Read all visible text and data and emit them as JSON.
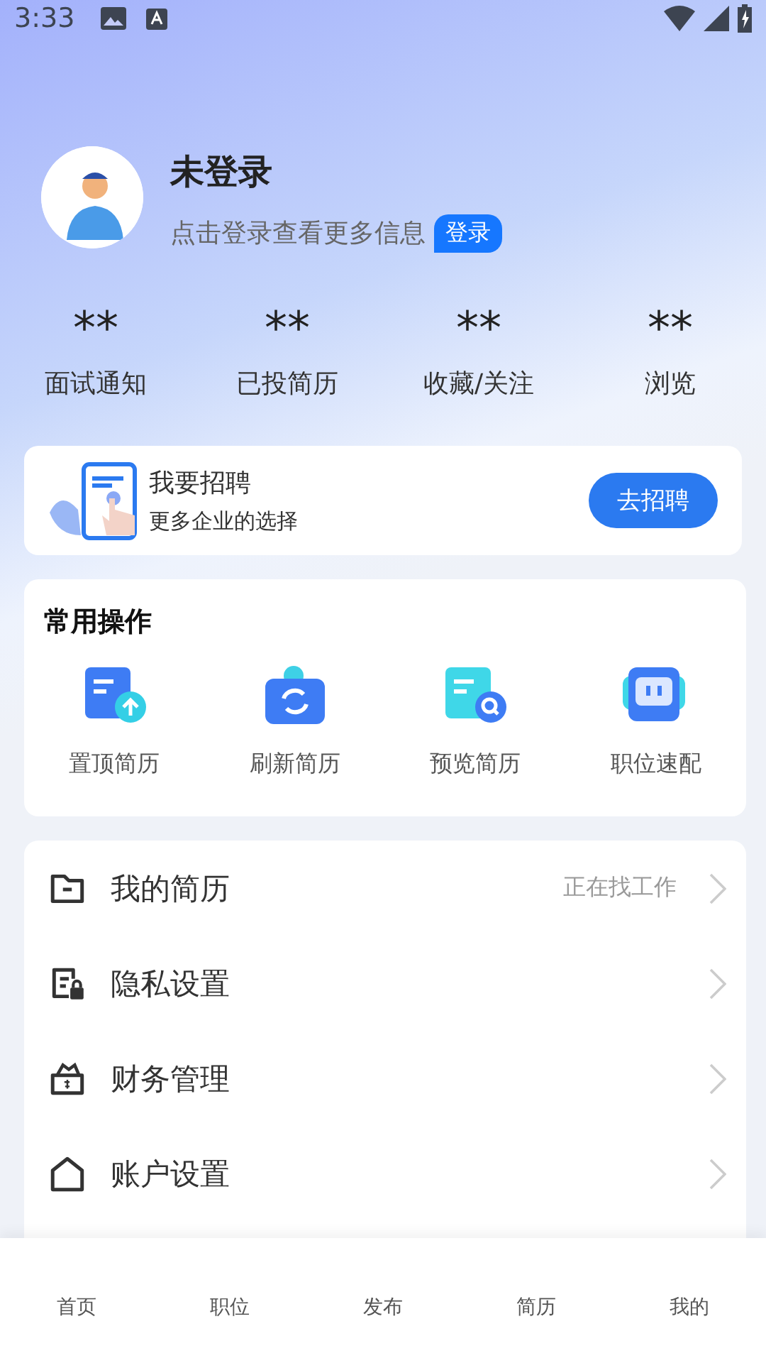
{
  "status_bar": {
    "time": "3:33"
  },
  "profile": {
    "name": "未登录",
    "hint": "点击登录查看更多信息",
    "login_button": "登录"
  },
  "stats": [
    {
      "value": "**",
      "label": "面试通知"
    },
    {
      "value": "**",
      "label": "已投简历"
    },
    {
      "value": "**",
      "label": "收藏/关注"
    },
    {
      "value": "**",
      "label": "浏览"
    }
  ],
  "recruit_card": {
    "title": "我要招聘",
    "subtitle": "更多企业的选择",
    "button": "去招聘"
  },
  "common_actions": {
    "title": "常用操作",
    "items": [
      {
        "kind": "pin",
        "label": "置顶简历"
      },
      {
        "kind": "refresh",
        "label": "刷新简历"
      },
      {
        "kind": "preview",
        "label": "预览简历"
      },
      {
        "kind": "match",
        "label": "职位速配"
      }
    ]
  },
  "menu": [
    {
      "kind": "folder",
      "label": "我的简历",
      "value": "正在找工作"
    },
    {
      "kind": "privacy",
      "label": "隐私设置"
    },
    {
      "kind": "finance",
      "label": "财务管理"
    },
    {
      "kind": "account",
      "label": "账户设置"
    }
  ],
  "bottom_nav": [
    {
      "label": "首页"
    },
    {
      "label": "职位"
    },
    {
      "label": "发布"
    },
    {
      "label": "简历"
    },
    {
      "label": "我的"
    }
  ]
}
